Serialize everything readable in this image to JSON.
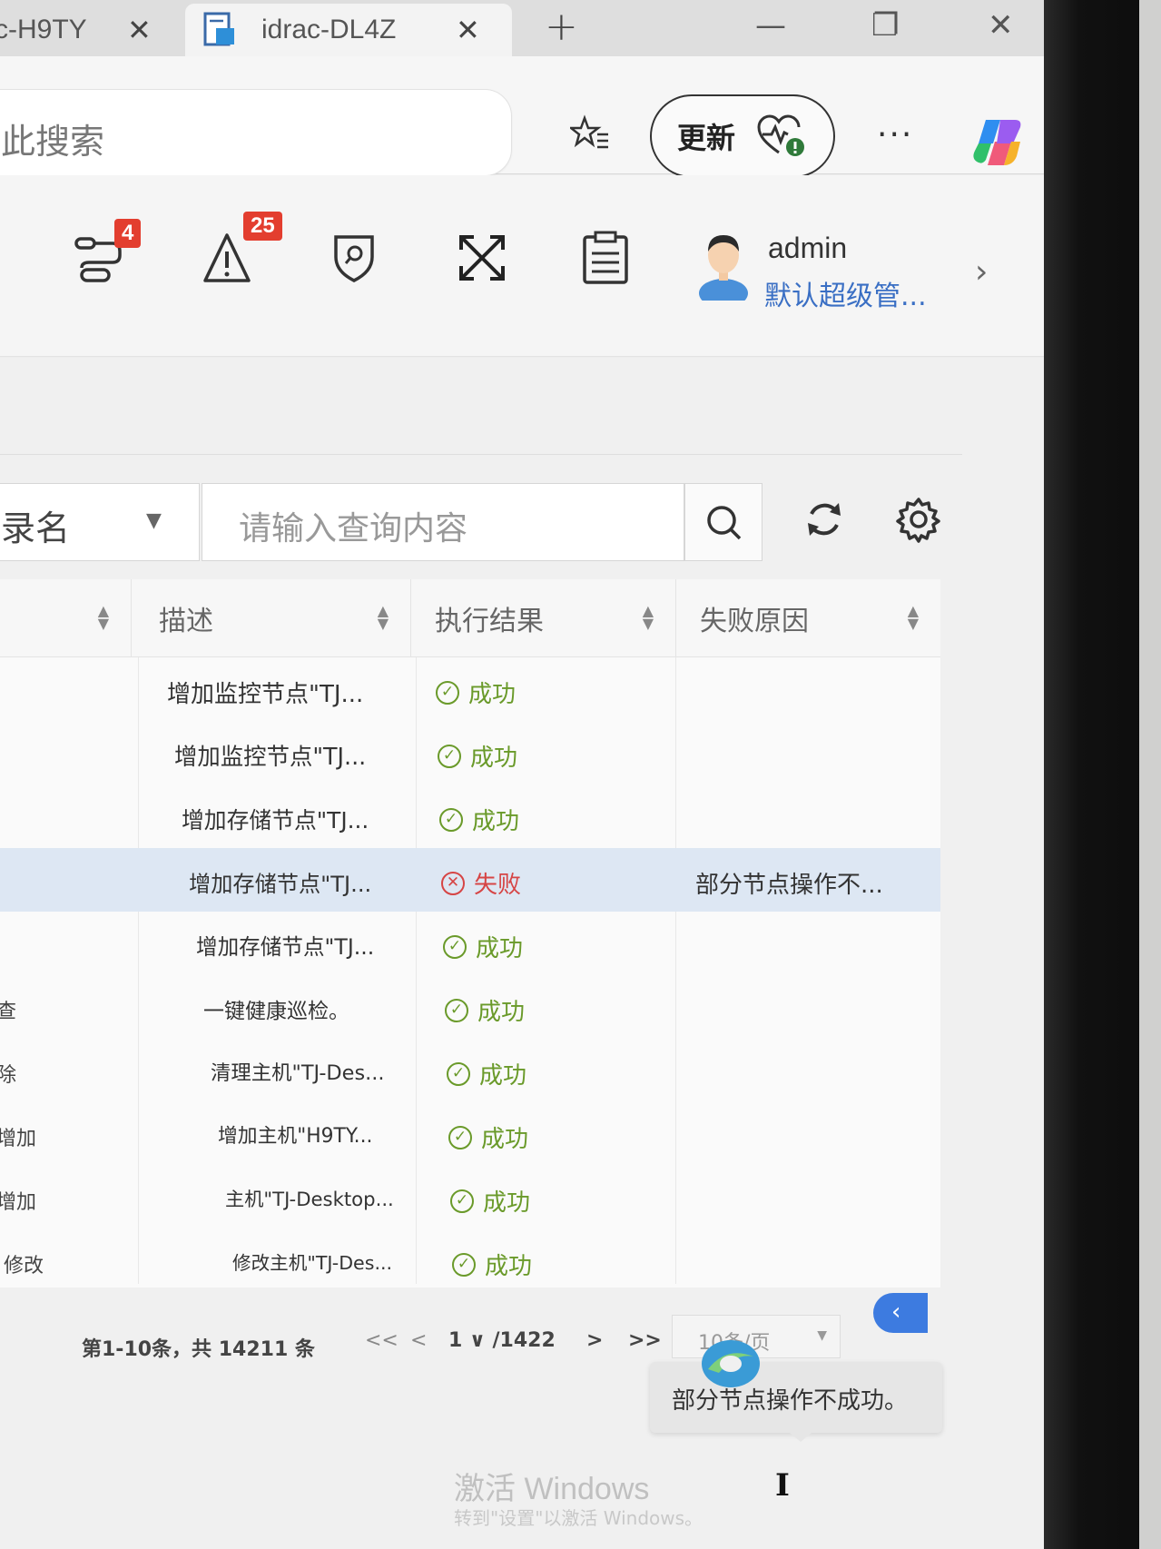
{
  "browser": {
    "tabs": [
      {
        "title": "c-H9TY",
        "active": false
      },
      {
        "title": "idrac-DL4Z",
        "active": true
      }
    ],
    "new_tab": "+",
    "address_text": "此搜索",
    "update_label": "更新",
    "more": "···"
  },
  "header": {
    "icons": [
      {
        "name": "workflow-icon",
        "badge": "4"
      },
      {
        "name": "alert-icon",
        "badge": "25"
      },
      {
        "name": "shield-search-icon",
        "badge": ""
      },
      {
        "name": "fullscreen-icon",
        "badge": ""
      },
      {
        "name": "clipboard-icon",
        "badge": ""
      }
    ],
    "user": {
      "name": "admin",
      "role": "默认超级管..."
    },
    "chevron": "›"
  },
  "filter": {
    "select_value": "录名",
    "placeholder": "请输入查询内容"
  },
  "table": {
    "columns": [
      "",
      "描述",
      "执行结果",
      "失败原因"
    ],
    "rows": [
      {
        "left": "",
        "desc": "增加监控节点\"TJ...",
        "result": "成功",
        "status": "ok",
        "reason": ""
      },
      {
        "left": "",
        "desc": "增加监控节点\"TJ...",
        "result": "成功",
        "status": "ok",
        "reason": ""
      },
      {
        "left": "",
        "desc": "增加存储节点\"TJ...",
        "result": "成功",
        "status": "ok",
        "reason": ""
      },
      {
        "left": "",
        "desc": "增加存储节点\"TJ...",
        "result": "失败",
        "status": "fail",
        "reason": "部分节点操作不..."
      },
      {
        "left": "",
        "desc": "增加存储节点\"TJ...",
        "result": "成功",
        "status": "ok",
        "reason": ""
      },
      {
        "left": "查",
        "desc": "一键健康巡检。",
        "result": "成功",
        "status": "ok",
        "reason": ""
      },
      {
        "left": "除",
        "desc": "清理主机\"TJ-Des...",
        "result": "成功",
        "status": "ok",
        "reason": ""
      },
      {
        "left": "增加",
        "desc": "增加主机\"H9TY...",
        "result": "成功",
        "status": "ok",
        "reason": ""
      },
      {
        "left": "增加",
        "desc": "主机\"TJ-Desktop...",
        "result": "成功",
        "status": "ok",
        "reason": ""
      },
      {
        "left": "修改",
        "desc": "修改主机\"TJ-Des...",
        "result": "成功",
        "status": "ok",
        "reason": ""
      }
    ],
    "tooltip": "部分节点操作不成功。"
  },
  "pagination": {
    "total": "第1-10条，共 14211 条",
    "first": "<<",
    "prev": "<",
    "current": "1 ∨ /1422",
    "next": ">",
    "last": ">>",
    "page_size": "10条/页"
  },
  "watermark": {
    "title": "激活 Windows",
    "sub": "转到\"设置\"以激活 Windows。"
  },
  "colors": {
    "success": "#6a9a2a",
    "fail": "#d64545",
    "badge": "#e33e2f",
    "accent": "#3d7be0"
  }
}
